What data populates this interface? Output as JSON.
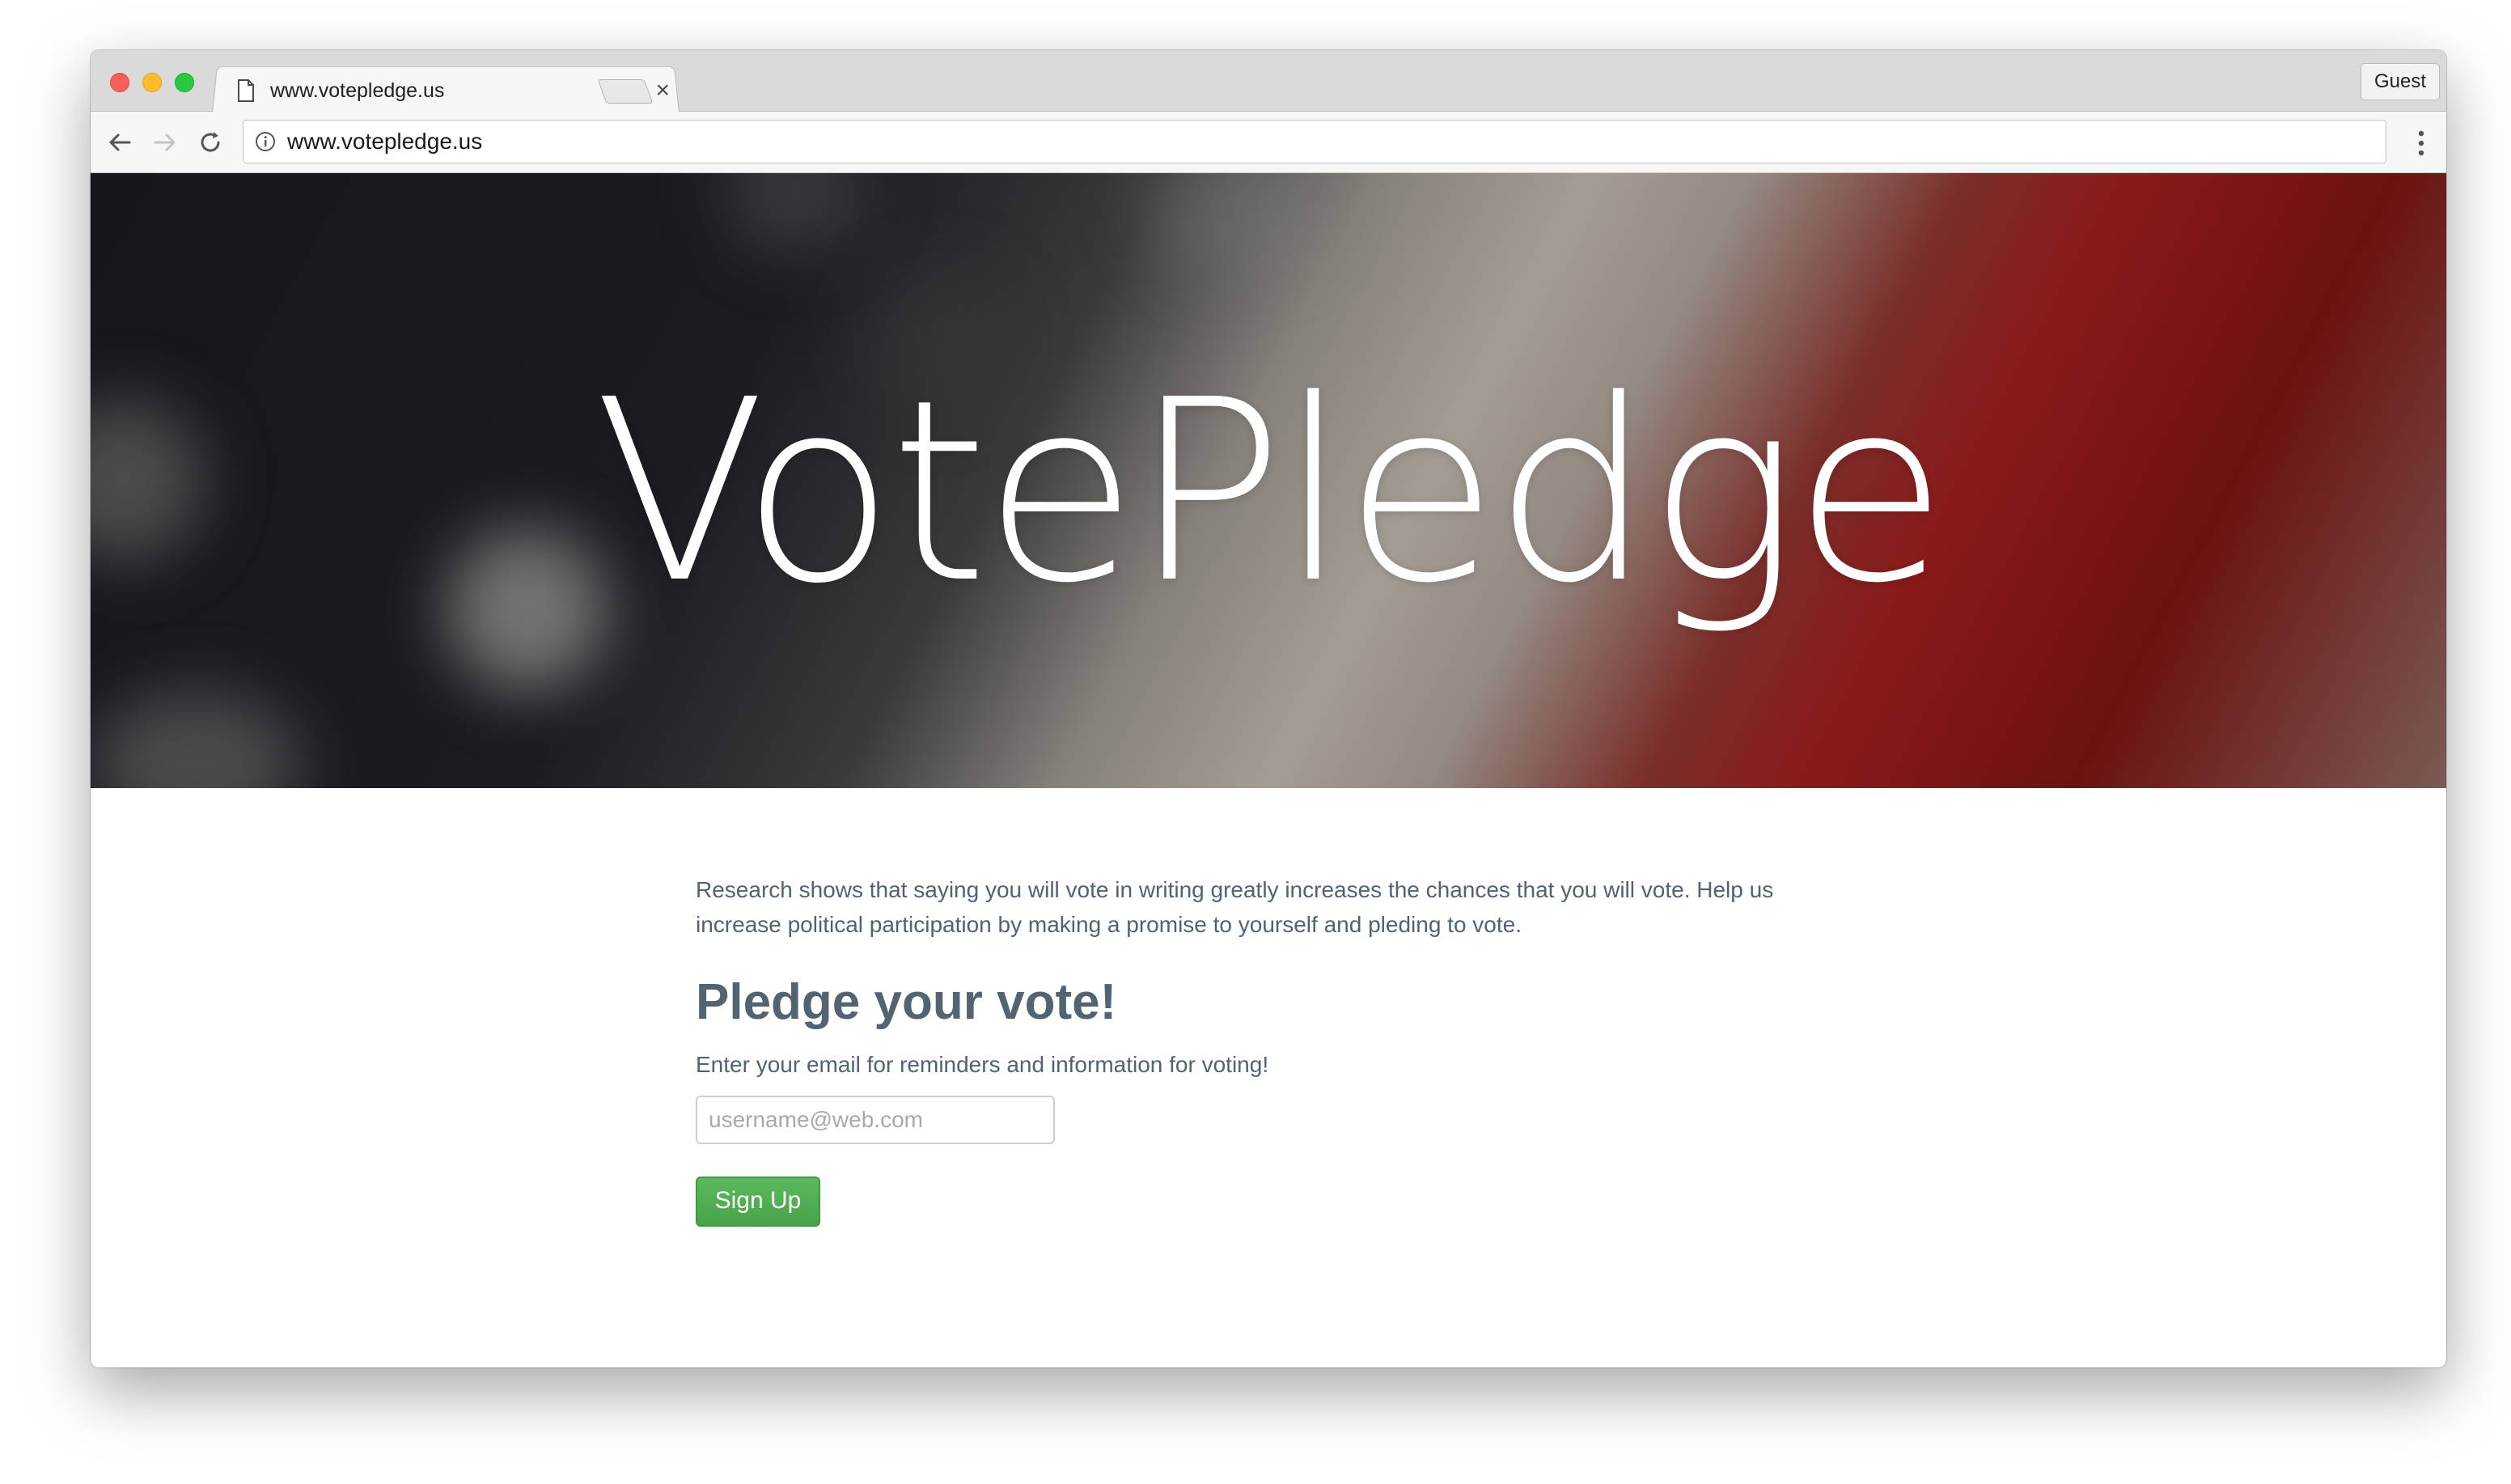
{
  "browser": {
    "tab_title": "www.votepledge.us",
    "tab_close": "×",
    "guest_label": "Guest",
    "url": "www.votepledge.us"
  },
  "icons": {
    "back": "back-arrow-icon",
    "forward": "forward-arrow-icon",
    "reload": "reload-icon",
    "info": "info-icon",
    "menu": "menu-dots-icon",
    "page": "document-icon"
  },
  "hero": {
    "title": "VotePledge"
  },
  "main": {
    "intro": "Research shows that saying you will vote in writing greatly increases the chances that you will vote. Help us increase political participation by making a promise to yourself and pleding to vote.",
    "heading": "Pledge your vote!",
    "subtext": "Enter your email for reminders and information for voting!",
    "email_placeholder": "username@web.com",
    "email_value": "",
    "signup_label": "Sign Up"
  },
  "colors": {
    "accent_green": "#5cb85c",
    "text_slate": "#526472",
    "flag_red": "#8a1a1a",
    "flag_navy": "#16171c"
  }
}
